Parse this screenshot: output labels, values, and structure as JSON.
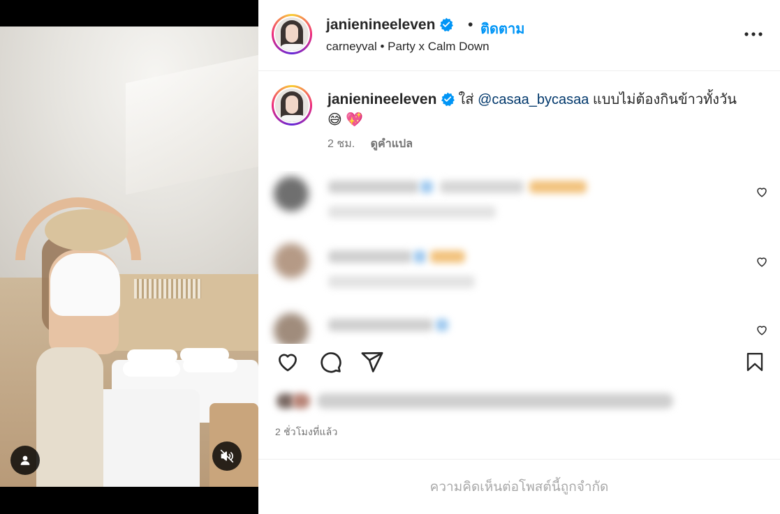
{
  "post": {
    "author": {
      "username": "janienineeleven",
      "verified": true,
      "avatar_icon": "profile-photo"
    },
    "header": {
      "separator": "•",
      "follow_label": "ติดตาม",
      "audio": "carneyval • Party x Calm Down",
      "more_icon": "more-horizontal-icon"
    },
    "caption": {
      "username": "janienineeleven",
      "text_before": "ใส่ ",
      "mention": "@casaa_bycasaa",
      "text_after": " แบบไม่ต้องกินข้าวทั้งวัน",
      "emojis": "😅 💖",
      "time": "2 ชม.",
      "translate_label": "ดูคำแปล"
    },
    "time_ago": "2 ชั่วโมงที่แล้ว",
    "comments_limited": "ความคิดเห็นต่อโพสต์นี้ถูกจำกัด"
  },
  "colors": {
    "accent": "#0095f6",
    "mention": "#00376b",
    "muted": "#737373",
    "disabled": "#a8a8a8",
    "verified": "#0095f6"
  },
  "icons": {
    "like": "heart-icon",
    "comment": "comment-icon",
    "share": "paper-plane-icon",
    "save": "bookmark-icon",
    "user_tag": "user-icon",
    "mute": "speaker-muted-icon"
  }
}
